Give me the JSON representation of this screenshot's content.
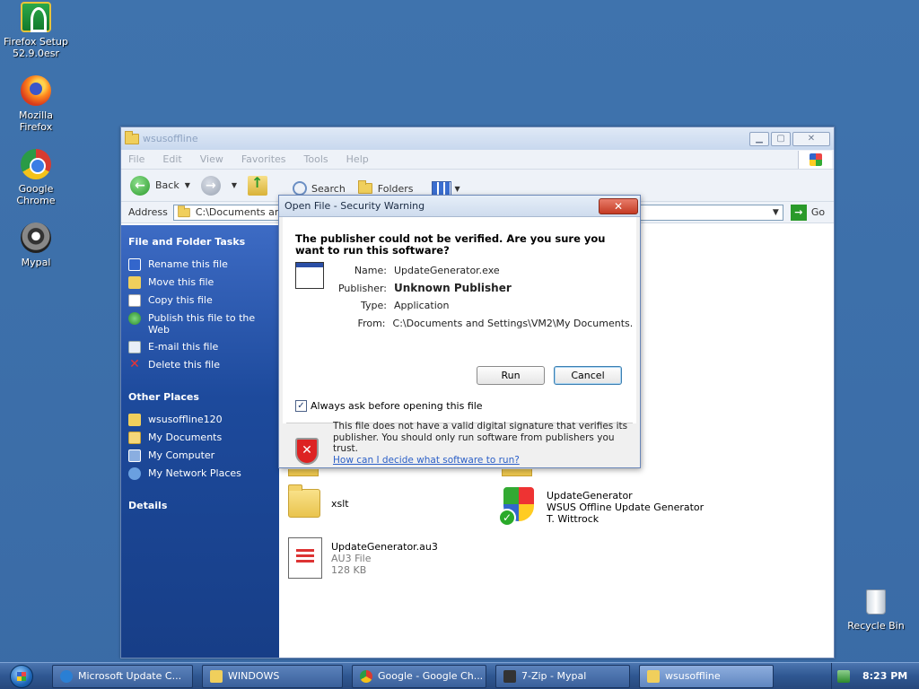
{
  "desktop": {
    "icons": [
      {
        "label_line1": "Firefox Setup",
        "label_line2": "52.9.0esr",
        "icon": "firefox-setup-icon"
      },
      {
        "label_line1": "Mozilla",
        "label_line2": "Firefox",
        "icon": "firefox-icon"
      },
      {
        "label_line1": "Google",
        "label_line2": "Chrome",
        "icon": "chrome-icon"
      },
      {
        "label_line1": "Mypal",
        "label_line2": "",
        "icon": "mypal-icon"
      }
    ],
    "recycle_bin": "Recycle Bin"
  },
  "explorer": {
    "title": "wsusoffline",
    "menu": [
      "File",
      "Edit",
      "View",
      "Favorites",
      "Tools",
      "Help"
    ],
    "toolbar": {
      "back": "Back",
      "search": "Search",
      "folders": "Folders"
    },
    "address": {
      "label": "Address",
      "value": "C:\\Documents and",
      "go": "Go"
    },
    "left_pane": {
      "tasks_title": "File and Folder Tasks",
      "tasks": [
        "Rename this file",
        "Move this file",
        "Copy this file",
        "Publish this file to the Web",
        "E-mail this file",
        "Delete this file"
      ],
      "places_title": "Other Places",
      "places": [
        "wsusoffline120",
        "My Documents",
        "My Computer",
        "My Network Places"
      ],
      "details_title": "Details"
    },
    "files": {
      "xslt": "xslt",
      "updategen": {
        "name": "UpdateGenerator",
        "desc": "WSUS Offline Update Generator",
        "author": "T. Wittrock"
      },
      "au3": {
        "name": "UpdateGenerator.au3",
        "type": "AU3 File",
        "size": "128 KB"
      }
    }
  },
  "dialog": {
    "title": "Open File - Security Warning",
    "close": "✕",
    "heading": "The publisher could not be verified.  Are you sure you want to run this software?",
    "props": [
      {
        "key": "Name:",
        "value": "UpdateGenerator.exe"
      },
      {
        "key": "Publisher:",
        "value": "Unknown Publisher"
      },
      {
        "key": "Type:",
        "value": "Application"
      },
      {
        "key": "From:",
        "value": "C:\\Documents and Settings\\VM2\\My Documents..."
      }
    ],
    "run_label": "Run",
    "cancel_label": "Cancel",
    "checkbox_label": "Always ask before opening this file",
    "checkbox_checked": true,
    "warning_text": "This file does not have a valid digital signature that verifies its publisher.  You should only run software from publishers you trust.",
    "warning_link": "How can I decide what software to run?"
  },
  "taskbar": {
    "tasks": [
      {
        "label": "Microsoft Update C...",
        "icon": "ie-icon"
      },
      {
        "label": "WINDOWS",
        "icon": "folder-icon"
      },
      {
        "label": "Google - Google Ch...",
        "icon": "chrome-icon"
      },
      {
        "label": "7-Zip - Mypal",
        "icon": "7zip-icon"
      },
      {
        "label": "wsusoffline",
        "icon": "folder-icon"
      }
    ],
    "clock": "8:23 PM"
  }
}
